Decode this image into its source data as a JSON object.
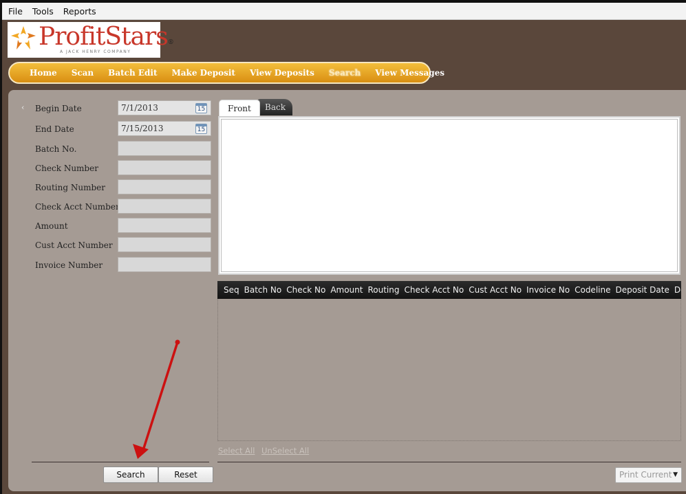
{
  "menubar": {
    "items": [
      "File",
      "Tools",
      "Reports"
    ]
  },
  "logo": {
    "word1": "Profit",
    "word2": "Stars",
    "tagline": "A JACK HENRY COMPANY",
    "mark": "®"
  },
  "nav": {
    "items": [
      "Home",
      "Scan",
      "Batch Edit",
      "Make Deposit",
      "View Deposits",
      "Search",
      "View Messages"
    ],
    "active": "Search"
  },
  "form": {
    "begin_date_label": "Begin Date",
    "begin_date_value": "7/1/2013",
    "end_date_label": "End Date",
    "end_date_value": "7/15/2013",
    "calendar_day": "15",
    "batch_no_label": "Batch No.",
    "check_number_label": "Check Number",
    "routing_number_label": "Routing Number",
    "check_acct_label": "Check Acct Number",
    "amount_label": "Amount",
    "cust_acct_label": "Cust Acct Number",
    "invoice_label": "Invoice Number"
  },
  "tabs": {
    "front": "Front",
    "back": "Back"
  },
  "grid": {
    "columns": [
      "Seq",
      "Batch No",
      "Check No",
      "Amount",
      "Routing",
      "Check Acct No",
      "Cust Acct No",
      "Invoice No",
      "Codeline",
      "Deposit Date",
      "De"
    ]
  },
  "links": {
    "select_all": "Select All",
    "unselect_all": "UnSelect All"
  },
  "buttons": {
    "search": "Search",
    "reset": "Reset"
  },
  "print": {
    "selected": "Print Current"
  },
  "colors": {
    "nav_gold": "#e8a421",
    "brand_red": "#c8372a",
    "panel": "#a59b94",
    "background": "#5a473b",
    "annotation_arrow": "#cc1111"
  }
}
